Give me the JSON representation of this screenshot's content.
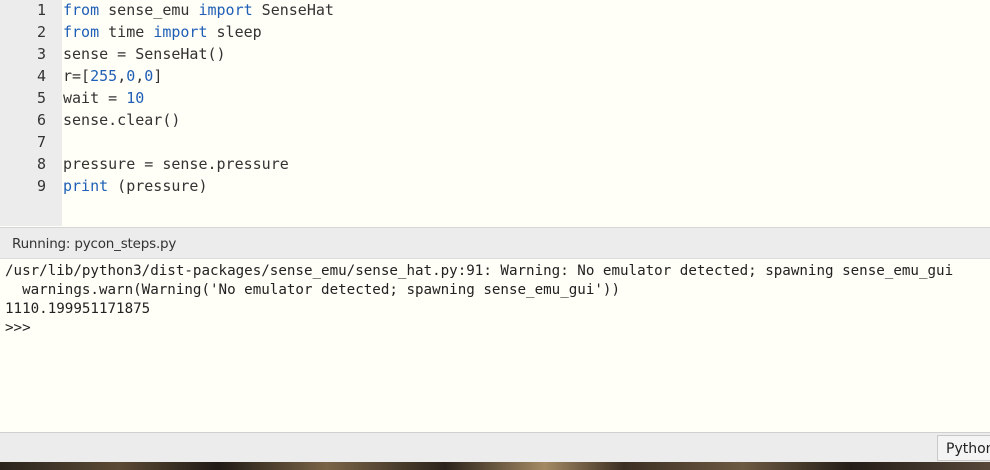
{
  "editor": {
    "lines": [
      {
        "n": "1",
        "tokens": [
          {
            "t": "from",
            "c": "kw"
          },
          {
            "t": " sense_emu ",
            "c": "plain"
          },
          {
            "t": "import",
            "c": "kw"
          },
          {
            "t": " SenseHat",
            "c": "plain"
          }
        ]
      },
      {
        "n": "2",
        "tokens": [
          {
            "t": "from",
            "c": "kw"
          },
          {
            "t": " time ",
            "c": "plain"
          },
          {
            "t": "import",
            "c": "kw"
          },
          {
            "t": " sleep",
            "c": "plain"
          }
        ]
      },
      {
        "n": "3",
        "tokens": [
          {
            "t": "sense = SenseHat()",
            "c": "plain"
          }
        ]
      },
      {
        "n": "4",
        "tokens": [
          {
            "t": "r=[",
            "c": "plain"
          },
          {
            "t": "255",
            "c": "num"
          },
          {
            "t": ",",
            "c": "plain"
          },
          {
            "t": "0",
            "c": "num"
          },
          {
            "t": ",",
            "c": "plain"
          },
          {
            "t": "0",
            "c": "num"
          },
          {
            "t": "]",
            "c": "plain"
          }
        ]
      },
      {
        "n": "5",
        "tokens": [
          {
            "t": "wait = ",
            "c": "plain"
          },
          {
            "t": "10",
            "c": "num"
          }
        ]
      },
      {
        "n": "6",
        "tokens": [
          {
            "t": "sense.clear()",
            "c": "plain"
          }
        ]
      },
      {
        "n": "7",
        "tokens": []
      },
      {
        "n": "8",
        "tokens": [
          {
            "t": "pressure = sense.pressure",
            "c": "plain"
          }
        ]
      },
      {
        "n": "9",
        "tokens": [
          {
            "t": "print",
            "c": "kw"
          },
          {
            "t": " (pressure)",
            "c": "plain"
          }
        ]
      }
    ]
  },
  "shell": {
    "title": "Running: pycon_steps.py",
    "output": [
      "/usr/lib/python3/dist-packages/sense_emu/sense_hat.py:91: Warning: No emulator detected; spawning sense_emu_gui",
      "  warnings.warn(Warning('No emulator detected; spawning sense_emu_gui'))",
      "1110.199951171875",
      ">>> "
    ]
  },
  "statusbar": {
    "interpreter": "Python"
  },
  "colors": {
    "keyword": "#1f5fb6",
    "background": "#fffef7",
    "gutter": "#ececec"
  }
}
